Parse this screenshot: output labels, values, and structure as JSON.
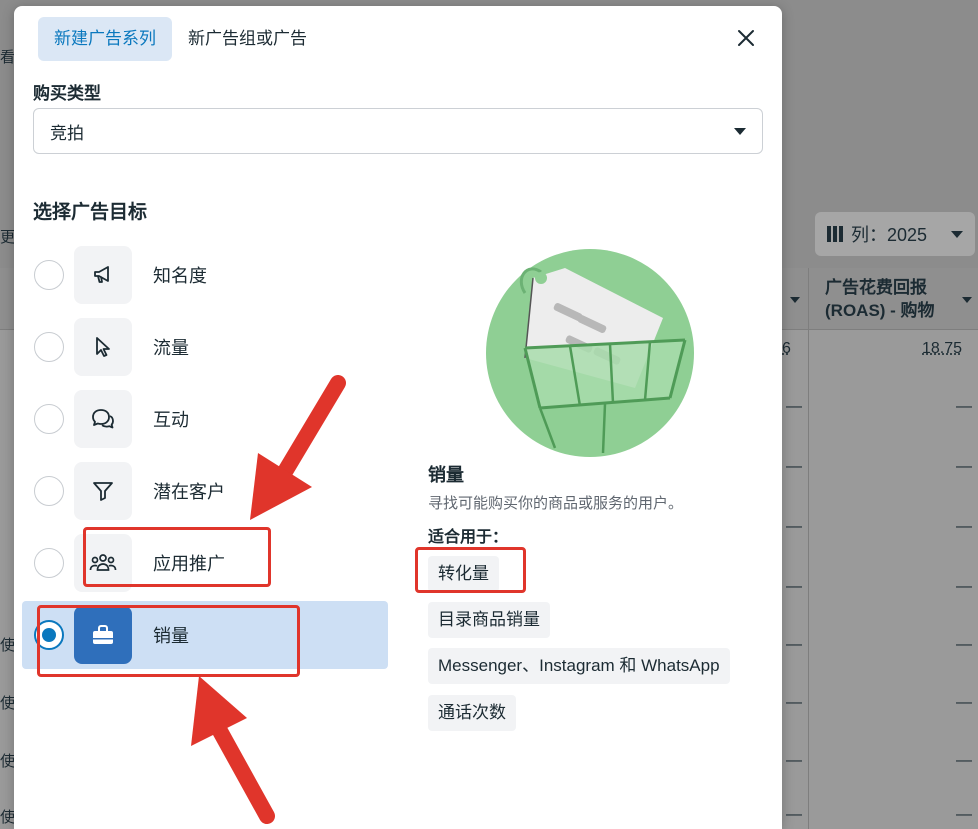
{
  "background": {
    "columns_button": "列：2025",
    "column_header": "广告花费回报 (ROAS) - 购物",
    "cell_values": [
      "6",
      "18.75"
    ],
    "dash": "—",
    "left_fragments": [
      "看",
      "更",
      "使用",
      "使用",
      "使用",
      "使用"
    ]
  },
  "modal": {
    "tabs": [
      {
        "label": "新建广告系列",
        "active": true
      },
      {
        "label": "新广告组或广告",
        "active": false
      }
    ],
    "purchase_type": {
      "label": "购买类型",
      "value": "竞拍"
    },
    "objective_title": "选择广告目标",
    "objectives": [
      {
        "label": "知名度",
        "icon": "megaphone-icon",
        "selected": false
      },
      {
        "label": "流量",
        "icon": "cursor-icon",
        "selected": false
      },
      {
        "label": "互动",
        "icon": "chat-bubbles-icon",
        "selected": false
      },
      {
        "label": "潜在客户",
        "icon": "funnel-icon",
        "selected": false
      },
      {
        "label": "应用推广",
        "icon": "people-icon",
        "selected": false
      },
      {
        "label": "销量",
        "icon": "shopping-bag-icon",
        "selected": true
      }
    ],
    "detail": {
      "title": "销量",
      "description": "寻找可能购买你的商品或服务的用户。",
      "good_for_title": "适合用于：",
      "good_for": [
        "转化量",
        "目录商品销量",
        "Messenger、Instagram 和 WhatsApp",
        "通话次数"
      ]
    }
  },
  "colors": {
    "accent": "#0a78be",
    "selected_bg": "#cddff4",
    "annotation_red": "#e0352b",
    "illustration_green": "#8fcf94"
  }
}
